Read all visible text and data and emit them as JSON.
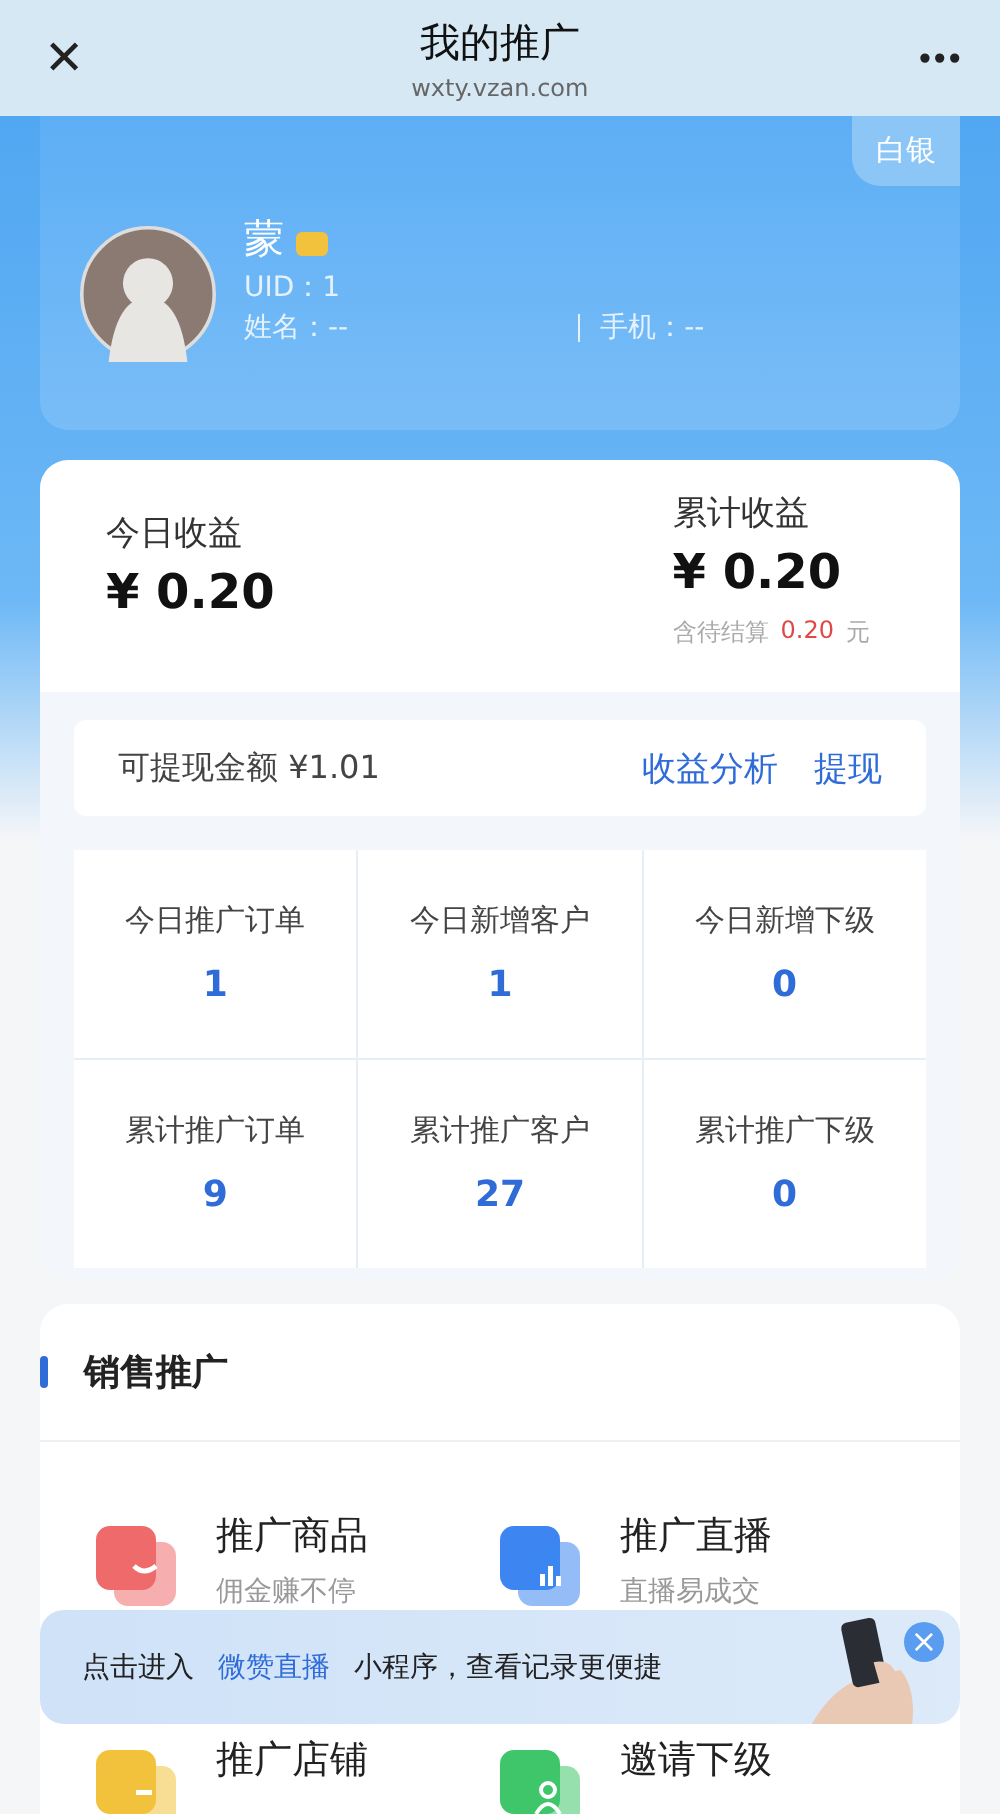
{
  "header": {
    "close": "✕",
    "title": "我的推广",
    "subtitle": "wxty.vzan.com",
    "more": "•••"
  },
  "profile": {
    "level_badge": "白银",
    "name": "蒙",
    "uid": "UID：1",
    "real_name": "姓名：--",
    "phone": "手机：--"
  },
  "earnings": {
    "today_label": "今日收益",
    "today_value": "¥ 0.20",
    "total_label": "累计收益",
    "total_value": "¥ 0.20",
    "pending_label": "含待结算",
    "pending_value": "0.20",
    "pending_unit": "元"
  },
  "withdraw": {
    "label": "可提现金额 ¥1.01",
    "analysis": "收益分析",
    "action": "提现"
  },
  "stats": [
    {
      "label": "今日推广订单",
      "value": "1"
    },
    {
      "label": "今日新增客户",
      "value": "1"
    },
    {
      "label": "今日新增下级",
      "value": "0"
    },
    {
      "label": "累计推广订单",
      "value": "9"
    },
    {
      "label": "累计推广客户",
      "value": "27"
    },
    {
      "label": "累计推广下级",
      "value": "0"
    }
  ],
  "sales": {
    "title": "销售推广",
    "items": [
      {
        "kind": "bag",
        "title": "推广商品",
        "subtitle": "佣金赚不停",
        "color": "#ef6b6b"
      },
      {
        "kind": "chart",
        "title": "推广直播",
        "subtitle": "直播易成交",
        "color": "#3d86f2"
      },
      {
        "kind": "store",
        "title": "推广店铺",
        "color": "#f3c23c"
      },
      {
        "kind": "person",
        "title": "邀请下级",
        "color": "#3fc66b"
      }
    ]
  },
  "banner": {
    "before": "点击进入",
    "link": "微赞直播",
    "after": "小程序，查看记录更便捷",
    "close": "×"
  }
}
